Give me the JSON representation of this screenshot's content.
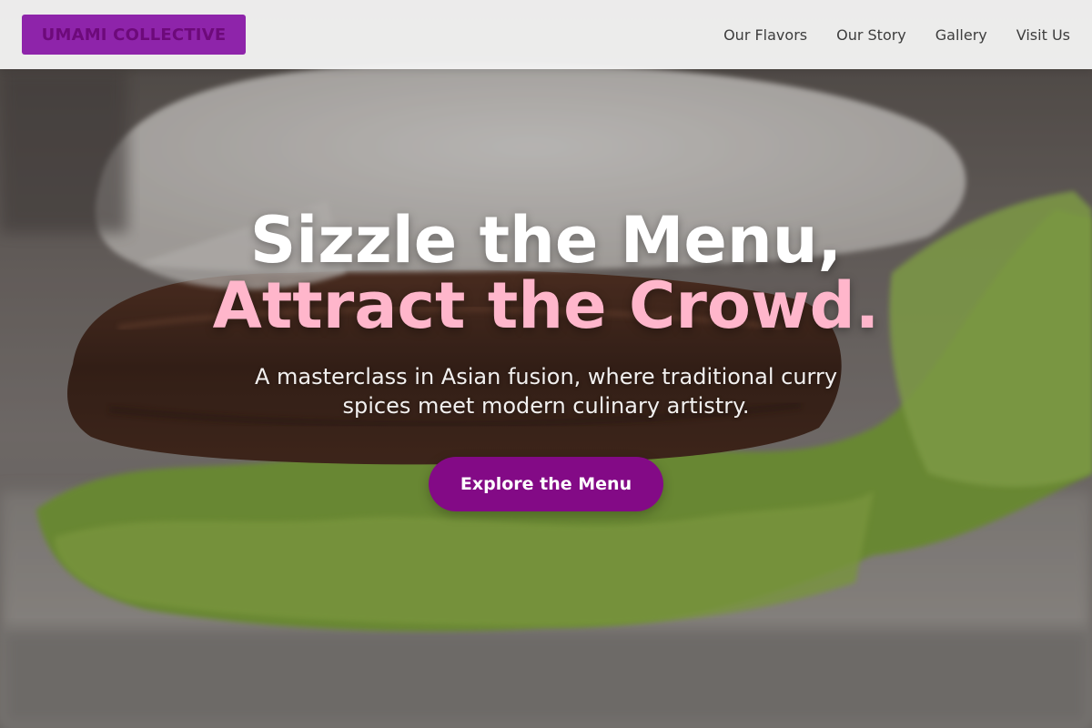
{
  "brand": {
    "name": "UMAMI COLLECTIVE"
  },
  "nav": {
    "items": [
      {
        "label": "Our Flavors"
      },
      {
        "label": "Our Story"
      },
      {
        "label": "Gallery"
      },
      {
        "label": "Visit Us"
      }
    ]
  },
  "hero": {
    "headline_line1": "Sizzle the Menu,",
    "headline_line2": "Attract the Crowd.",
    "subtitle": "A masterclass in Asian fusion, where traditional curry spices meet modern culinary artistry.",
    "cta_label": "Explore the Menu",
    "background_image": "bao-bun-food-photo"
  },
  "colors": {
    "brand_purple": "#8e24aa",
    "cta_purple": "#830a86",
    "accent_pink": "#ffb6cb",
    "header_bg": "#f3f3f3"
  }
}
